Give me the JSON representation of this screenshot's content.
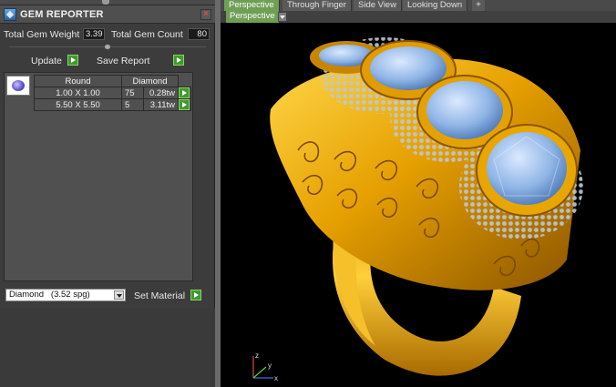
{
  "panel": {
    "title": "GEM REPORTER",
    "close_glyph": "×",
    "total_weight_label": "Total Gem Weight",
    "total_weight_value": "3.39",
    "total_count_label": "Total Gem Count",
    "total_count_value": "80",
    "update_label": "Update",
    "save_report_label": "Save Report",
    "table": {
      "headers": [
        "Round",
        "Diamond"
      ],
      "rows": [
        {
          "size": "1.00 X 1.00",
          "count": "75",
          "weight": "0.28tw"
        },
        {
          "size": "5.50 X 5.50",
          "count": "5",
          "weight": "3.11tw"
        }
      ]
    },
    "material_value": "Diamond   (3.52 spg)",
    "set_material_label": "Set Material"
  },
  "viewport": {
    "tabs": [
      "Perspective",
      "Through Finger",
      "Side View",
      "Looking Down"
    ],
    "add_tab_glyph": "+",
    "view_label": "Perspective",
    "axis": {
      "x": "x",
      "y": "y",
      "z": "z"
    }
  },
  "colors": {
    "accent_green": "#6f9e55",
    "go_green": "#3e9a2e",
    "gold": "#e6a800",
    "gem_blue": "#9fc3ee"
  }
}
